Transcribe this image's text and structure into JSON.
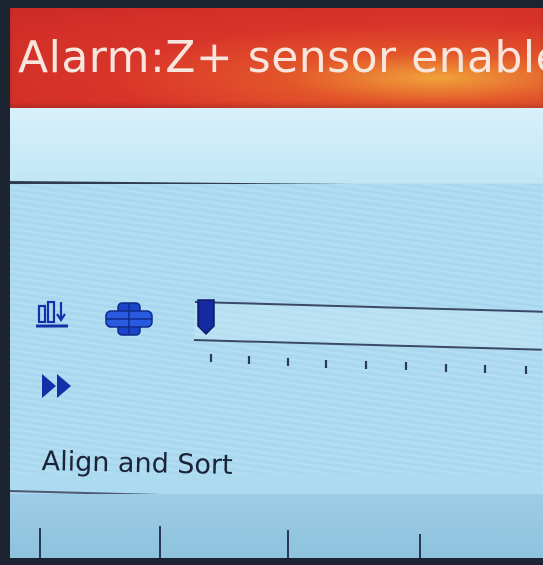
{
  "alarm": {
    "text": "Alarm:Z+ sensor enable",
    "color": "#d8342a"
  },
  "toolbar": {
    "icons": [
      {
        "name": "align-bottom-icon"
      },
      {
        "name": "center-align-icon"
      },
      {
        "name": "fast-forward-icon"
      }
    ]
  },
  "slider": {
    "value": 0,
    "tick_count": 9
  },
  "section": {
    "label": "Align and Sort"
  },
  "colors": {
    "accent": "#1430a8",
    "panel": "#b3ddf1",
    "text": "#1a2436"
  }
}
